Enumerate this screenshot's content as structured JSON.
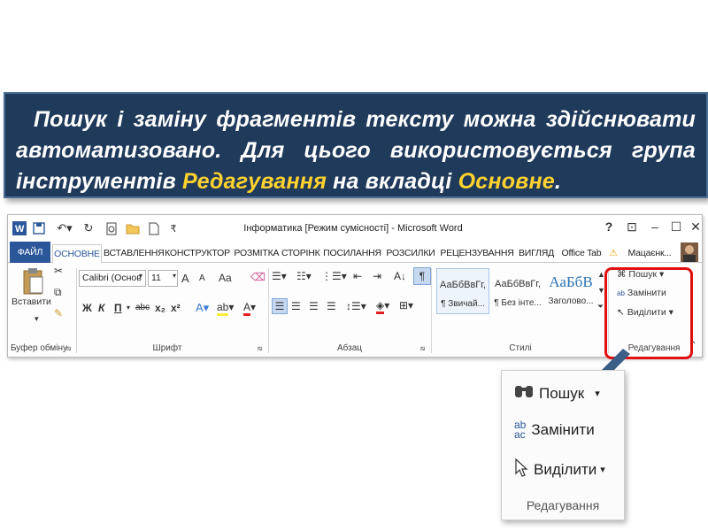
{
  "banner": {
    "part1": "Пошук і заміну фрагментів тексту можна здійснювати автоматизовано. Для цього використовується група інструментів ",
    "highlight1": "Редагування",
    "part2": " на вкладці ",
    "highlight2": "Основне",
    "part3": "."
  },
  "word": {
    "title": "Інформатика [Режим сумісності] - Microsoft Word",
    "help": "?",
    "tabs": [
      "ФАЙЛ",
      "ОСНОВНЕ",
      "ВСТАВЛЕННЯ",
      "КОНСТРУКТОР",
      "РОЗМІТКА СТОРІНК",
      "ПОСИЛАННЯ",
      "РОЗСИЛКИ",
      "РЕЦЕНЗУВАННЯ",
      "ВИГЛЯД",
      "Office Tab"
    ],
    "user": "Мацаєнк...",
    "clipboard": {
      "paste": "Вставити",
      "label": "Буфер обміну"
    },
    "font": {
      "name": "Calibri (Основ",
      "size": "11",
      "label": "Шрифт",
      "bold": "Ж",
      "italic": "К",
      "underline": "П",
      "strike": "abc",
      "sub": "x₂",
      "sup": "x²",
      "case": "Aa",
      "grow": "A",
      "shrink": "A"
    },
    "paragraph": {
      "label": "Абзац"
    },
    "styles": {
      "label": "Стилі",
      "items": [
        {
          "preview": "АаБбВвГг,",
          "name": "¶ Звичай..."
        },
        {
          "preview": "АаБбВвГг,",
          "name": "¶ Без інте..."
        },
        {
          "preview": "АаБбВ",
          "name": "Заголово..."
        }
      ]
    },
    "editing": {
      "find": "Пошук",
      "replace": "Замінити",
      "select": "Виділити",
      "label": "Редагування"
    }
  },
  "popup": {
    "find": "Пошук",
    "replace": "Замінити",
    "select": "Виділити",
    "label": "Редагування"
  },
  "colors": {
    "banner_bg": "#1f3a5a",
    "highlight": "#ffd22e",
    "accent": "#2b579a",
    "red_frame": "#e01010"
  }
}
